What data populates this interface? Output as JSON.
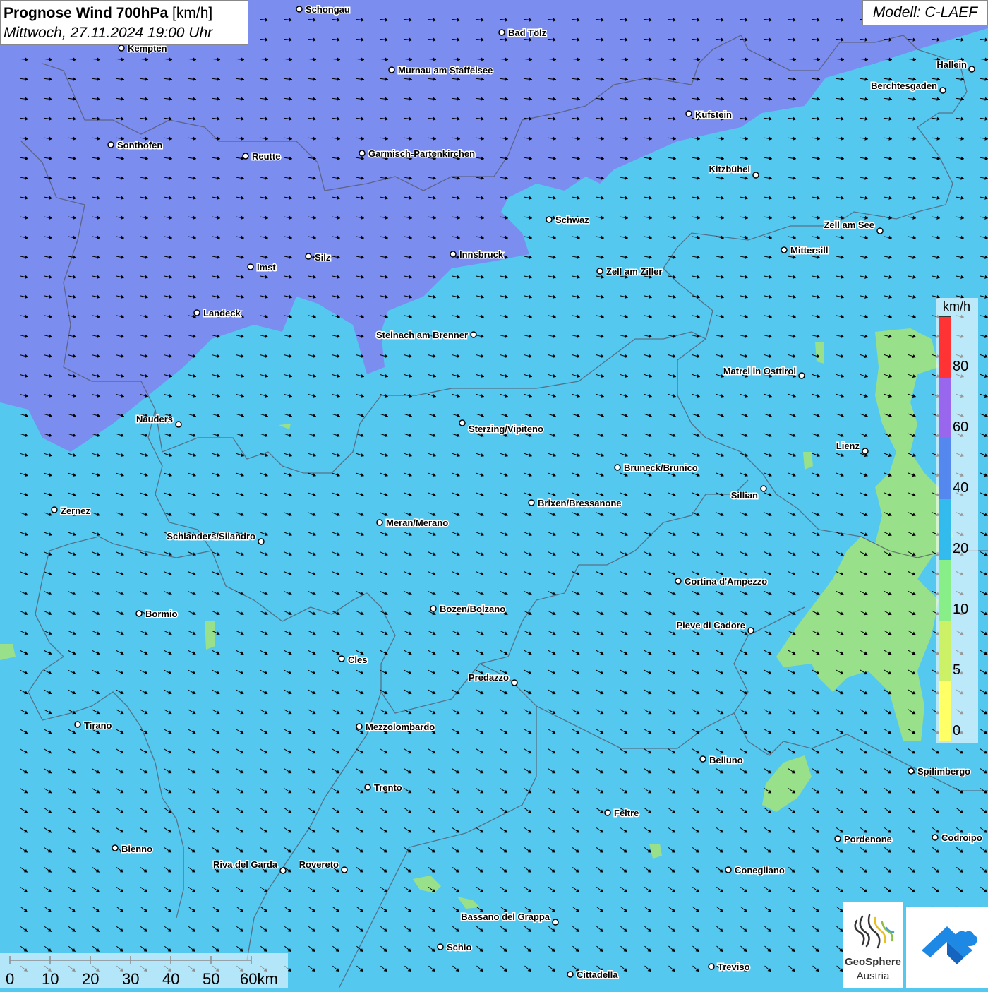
{
  "title": {
    "main": "Prognose Wind 700hPa",
    "unit": "[km/h]",
    "date": "Mittwoch, 27.11.2024 19:00 Uhr"
  },
  "model": "Modell: C-LAEF",
  "legend": {
    "unit": "km/h",
    "ticks": [
      "80",
      "60",
      "40",
      "20",
      "10",
      "5",
      "0"
    ],
    "colors": [
      "#ff3333",
      "#9966ee",
      "#5588ee",
      "#33bbee",
      "#88ee88",
      "#ccf066",
      "#ffff66"
    ]
  },
  "scalebar": {
    "labels": [
      "0",
      "10",
      "20",
      "30",
      "40",
      "50",
      "60km"
    ]
  },
  "logos": {
    "geosphere_line1": "GeoSphere",
    "geosphere_line2": "Austria"
  },
  "cities": [
    {
      "name": "Schongau"
    },
    {
      "name": "Bad Tölz"
    },
    {
      "name": "Kempten"
    },
    {
      "name": "Murnau am Staffelsee"
    },
    {
      "name": "Hallein"
    },
    {
      "name": "Berchtesgaden"
    },
    {
      "name": "Kufstein"
    },
    {
      "name": "Sonthofen"
    },
    {
      "name": "Reutte"
    },
    {
      "name": "Garmisch-Partenkirchen"
    },
    {
      "name": "Kitzbühel"
    },
    {
      "name": "Schwaz"
    },
    {
      "name": "Zell am See"
    },
    {
      "name": "Mittersill"
    },
    {
      "name": "Silz"
    },
    {
      "name": "Innsbruck"
    },
    {
      "name": "Imst"
    },
    {
      "name": "Zell am Ziller"
    },
    {
      "name": "Landeck"
    },
    {
      "name": "Steinach am Brenner"
    },
    {
      "name": "Matrei in Osttirol"
    },
    {
      "name": "Nauders"
    },
    {
      "name": "Sterzing/Vipiteno"
    },
    {
      "name": "Lienz"
    },
    {
      "name": "Bruneck/Brunico"
    },
    {
      "name": "Sillian"
    },
    {
      "name": "Brixen/Bressanone"
    },
    {
      "name": "Zernez"
    },
    {
      "name": "Meran/Merano"
    },
    {
      "name": "Schlanders/Silandro"
    },
    {
      "name": "Cortina d'Ampezzo"
    },
    {
      "name": "Bozen/Bolzano"
    },
    {
      "name": "Bormio"
    },
    {
      "name": "Pieve di Cadore"
    },
    {
      "name": "Cles"
    },
    {
      "name": "Predazzo"
    },
    {
      "name": "Tirano"
    },
    {
      "name": "Mezzolombardo"
    },
    {
      "name": "Belluno"
    },
    {
      "name": "Spilimbergo"
    },
    {
      "name": "Trento"
    },
    {
      "name": "Feltre"
    },
    {
      "name": "Pordenone"
    },
    {
      "name": "Codroipo"
    },
    {
      "name": "Bienno"
    },
    {
      "name": "Riva del Garda"
    },
    {
      "name": "Rovereto"
    },
    {
      "name": "Conegliano"
    },
    {
      "name": "Bassano del Grappa"
    },
    {
      "name": "Schio"
    },
    {
      "name": "Treviso"
    },
    {
      "name": "Cittadella"
    }
  ],
  "colors": {
    "zone_40_60": "#7b8ef0",
    "zone_20_40": "#55c8f0",
    "zone_10_20": "#99e08a",
    "arrow": "#000000"
  }
}
